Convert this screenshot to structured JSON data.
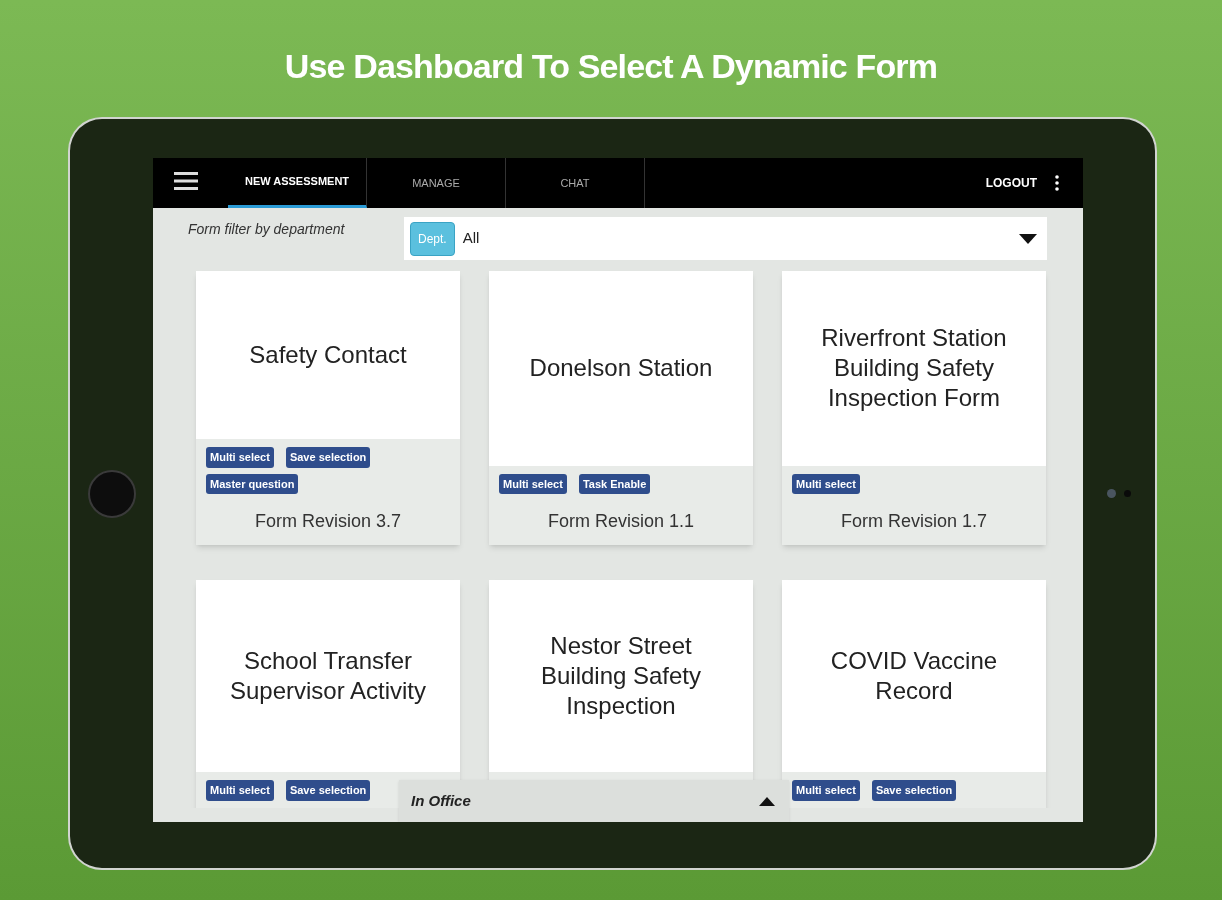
{
  "headline": "Use Dashboard To Select A Dynamic Form",
  "tabs": [
    {
      "label": "NEW ASSESSMENT",
      "selected": true
    },
    {
      "label": "MANAGE",
      "selected": false
    },
    {
      "label": "CHAT",
      "selected": false
    }
  ],
  "logout": "LOGOUT",
  "filter": {
    "label": "Form filter by department",
    "badge": "Dept.",
    "value": "All"
  },
  "forms": [
    {
      "title": "Safety Contact",
      "tags": [
        "Multi select",
        "Save selection",
        "Master question"
      ],
      "revision": "Form Revision 3.7"
    },
    {
      "title": "Donelson Station",
      "tags": [
        "Multi select",
        "Task Enable"
      ],
      "revision": "Form Revision 1.1"
    },
    {
      "title": "Riverfront Station Building Safety Inspection Form",
      "tags": [
        "Multi select"
      ],
      "revision": "Form Revision 1.7"
    },
    {
      "title": "School Transfer Supervisor Activity",
      "tags": [
        "Multi select",
        "Save selection"
      ]
    },
    {
      "title": "Nestor Street Building Safety Inspection"
    },
    {
      "title": "COVID Vaccine Record",
      "tags": [
        "Multi select",
        "Save selection"
      ]
    }
  ],
  "location_bar": {
    "label": "In Office",
    "expanded": false
  }
}
